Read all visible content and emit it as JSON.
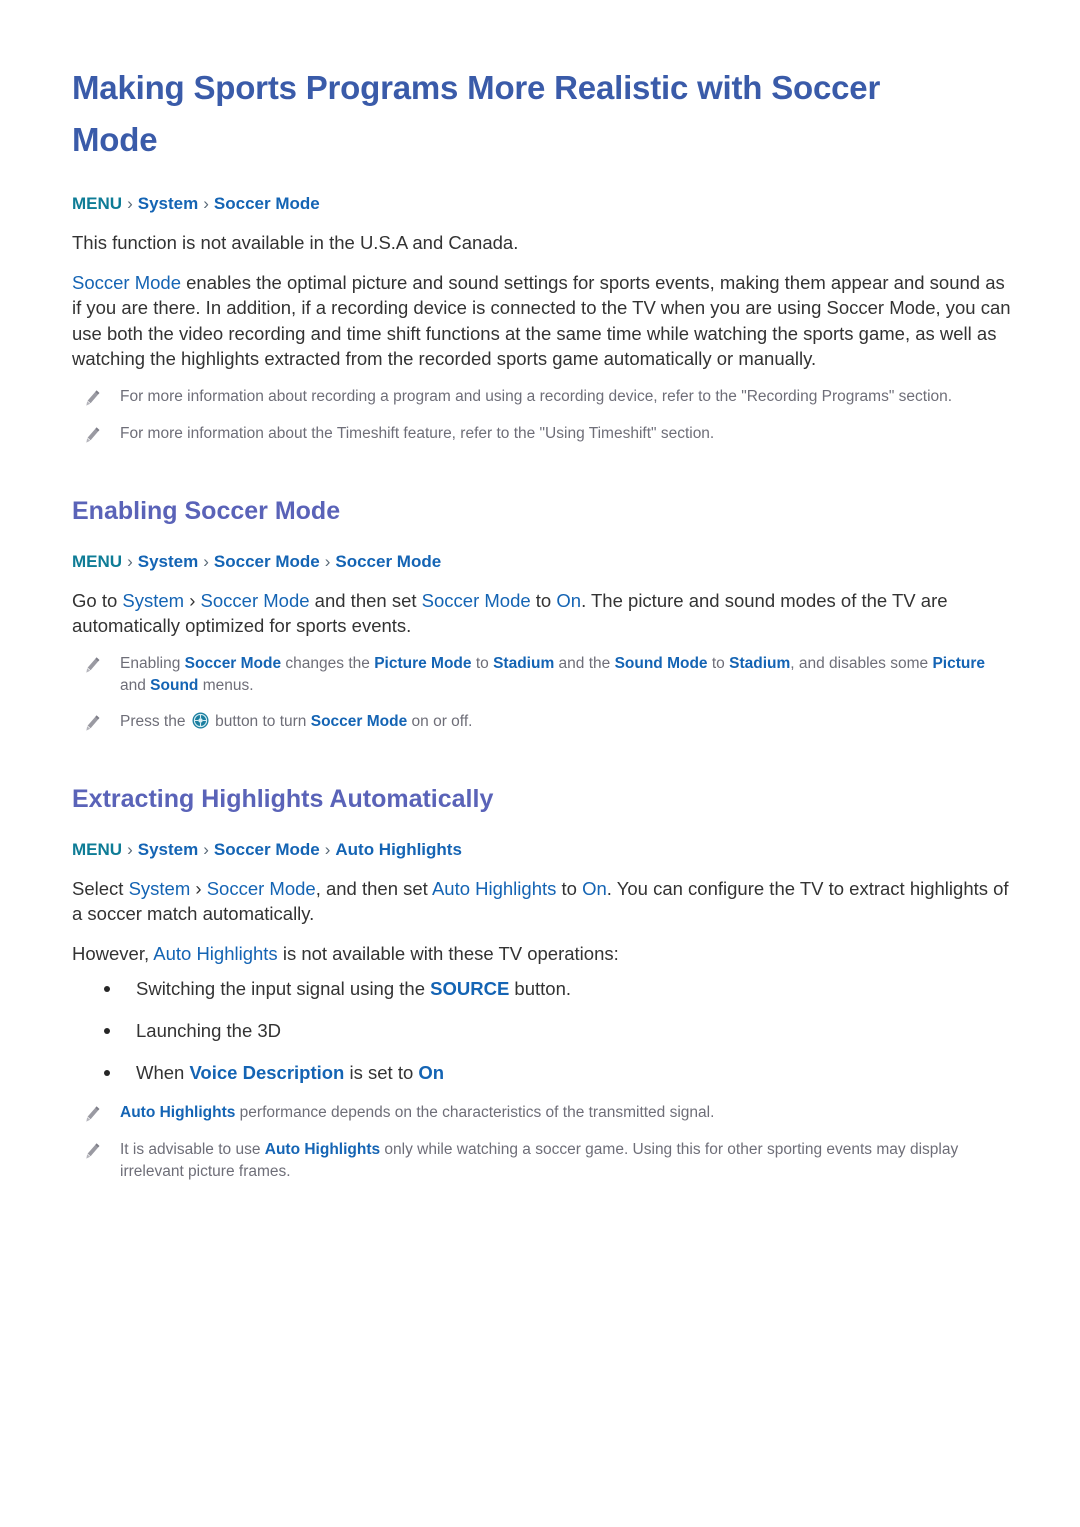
{
  "page": {
    "title": "Making Sports Programs More Realistic with Soccer Mode"
  },
  "colors": {
    "title_blue": "#3a5ba9",
    "heading_blue": "#5a63b8",
    "link_blue": "#1464b4",
    "menu_teal": "#0e7c96",
    "body_text": "#333333",
    "note_text": "#6e6e78",
    "icon_gray": "#9a9aa2",
    "ball_teal": "#1b7fa0",
    "background": "#ffffff"
  },
  "intro": {
    "breadcrumb": {
      "root": "MENU",
      "sep": "›",
      "items": [
        "System",
        "Soccer Mode"
      ]
    },
    "availability_note": "This function is not available in the U.S.A and Canada.",
    "paragraph_lead": "Soccer Mode",
    "paragraph_rest": " enables the optimal picture and sound settings for sports events, making them appear and sound as if you are there. In addition, if a recording device is connected to the TV when you are using Soccer Mode, you can use both the video recording and time shift functions at the same time while watching the sports game, as well as watching the highlights extracted from the recorded sports game automatically or manually.",
    "notes": [
      {
        "icon": "pencil-icon",
        "text": "For more information about recording a program and using a recording device, refer to the \"Recording Programs\" section."
      },
      {
        "icon": "pencil-icon",
        "text": "For more information about the Timeshift feature, refer to the \"Using Timeshift\" section."
      }
    ]
  },
  "section_enabling": {
    "heading": "Enabling Soccer Mode",
    "breadcrumb": {
      "root": "MENU",
      "sep": "›",
      "items": [
        "System",
        "Soccer Mode",
        "Soccer Mode"
      ]
    },
    "body": {
      "p1_a": "Go to ",
      "p1_link1": "System",
      "p1_sep": " › ",
      "p1_link2": "Soccer Mode",
      "p1_b": " and then set ",
      "p1_link3": "Soccer Mode",
      "p1_c": " to ",
      "p1_link4": "On",
      "p1_d": ". The picture and sound modes of the TV are automatically optimized for sports events."
    },
    "notes": [
      {
        "icon": "pencil-icon",
        "a": "Enabling ",
        "l1": "Soccer Mode",
        "b": " changes the ",
        "l2": "Picture Mode",
        "c": " to ",
        "l3": "Stadium",
        "d": " and the ",
        "l4": "Sound Mode",
        "e": " to ",
        "l5": "Stadium",
        "f": ", and disables some ",
        "l6": "Picture",
        "g": " and ",
        "l7": "Sound",
        "h": " menus."
      },
      {
        "icon": "pencil-icon",
        "a": "Press the ",
        "ball_icon": "soccer-ball-button-icon",
        "b": " button to turn ",
        "l1": "Soccer Mode",
        "c": " on or off."
      }
    ]
  },
  "section_highlights": {
    "heading": "Extracting Highlights Automatically",
    "breadcrumb": {
      "root": "MENU",
      "sep": "›",
      "items": [
        "System",
        "Soccer Mode",
        "Auto Highlights"
      ]
    },
    "body": {
      "p1_a": "Select ",
      "p1_link1": "System",
      "p1_sep": " › ",
      "p1_link2": "Soccer Mode",
      "p1_b": ", and then set ",
      "p1_link3": "Auto Highlights",
      "p1_c": " to ",
      "p1_link4": "On",
      "p1_d": ". You can configure the TV to extract highlights of a soccer match automatically."
    },
    "however": {
      "a": "However, ",
      "link": "Auto Highlights",
      "b": " is not available with these TV operations:"
    },
    "bullets": [
      {
        "a": "Switching the input signal using the ",
        "link": "SOURCE",
        "b": " button."
      },
      {
        "a": "Launching the 3D",
        "link": "",
        "b": ""
      },
      {
        "a": "When ",
        "link": "Voice Description",
        "b": " is set to ",
        "link2": "On"
      }
    ],
    "notes": [
      {
        "icon": "pencil-icon",
        "a": "",
        "l1": "Auto Highlights",
        "b": " performance depends on the characteristics of the transmitted signal."
      },
      {
        "icon": "pencil-icon",
        "a": "It is advisable to use ",
        "l1": "Auto Highlights",
        "b": " only while watching a soccer game. Using this for other sporting events may display irrelevant picture frames."
      }
    ]
  }
}
